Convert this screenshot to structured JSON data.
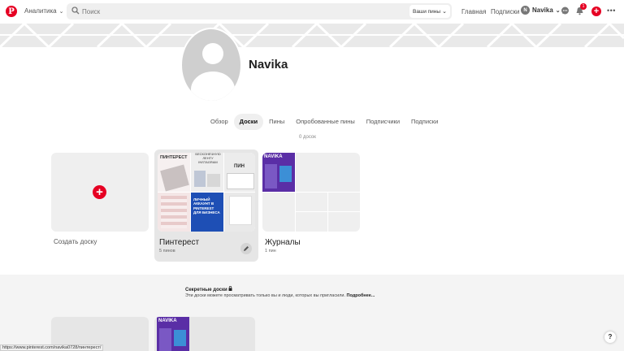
{
  "topbar": {
    "logo_letter": "P",
    "analytics_label": "Аналитика",
    "search_placeholder": "Поиск",
    "scope_label": "Ваши пины",
    "home_label": "Главная",
    "following_label": "Подписки",
    "user_initial": "N",
    "user_name": "Navika",
    "notifications_count": "1"
  },
  "profile": {
    "name": "Navika"
  },
  "tabs": [
    "Обзор",
    "Доски",
    "Пины",
    "Опробованные пины",
    "Подписчики",
    "Подписки"
  ],
  "active_tab": "Доски",
  "boards_count_label": "0 досок",
  "create_board_label": "Создать доску",
  "boards": [
    {
      "title": "Пинтерест",
      "pins": "5 пинов",
      "tiles": {
        "t1": "ПИНТЕРЕСТ",
        "t2": "БЕСКОНЕЧНУЮ ЛЕНТУ INSTAGRAM",
        "t3": "ПИН",
        "t5": "ЛИЧНЫЙ АККАУНТ В PINTEREST ДЛЯ БИЗНЕСА"
      }
    },
    {
      "title": "Журналы",
      "pins": "1 пин",
      "cover_text": "NAVIKA"
    }
  ],
  "secret": {
    "title": "Секретные доски",
    "description": "Эти доски можете просматривать только вы и люди, которых вы пригласили.",
    "more_link": "Подробнее...",
    "thumb_text": "NAVIKA"
  },
  "status_url": "https://www.pinterest.com/navika0728/пинтерест/",
  "help_label": "?",
  "colors": {
    "brand_red": "#e60023",
    "cover_gray": "#e9e9e9",
    "card_gray": "#efefef",
    "navika_purple": "#5a2ea6"
  }
}
